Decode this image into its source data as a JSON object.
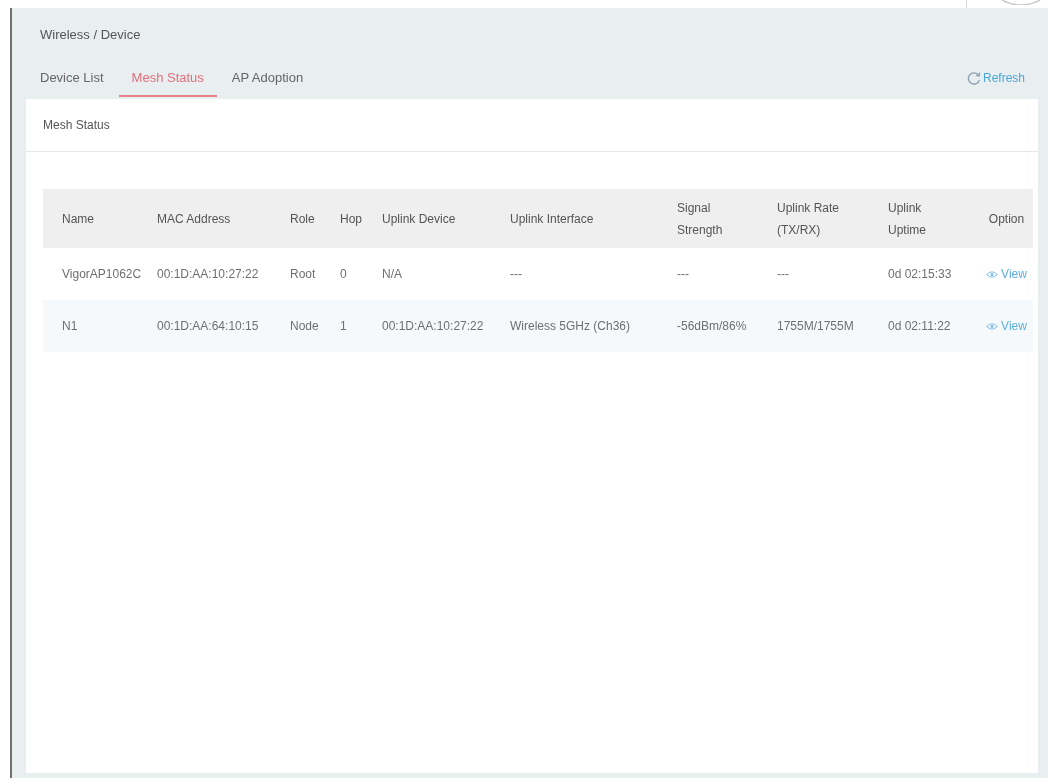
{
  "breadcrumb": "Wireless / Device",
  "tabs": [
    {
      "label": "Device List",
      "selected": false
    },
    {
      "label": "Mesh Status",
      "selected": true
    },
    {
      "label": "AP Adoption",
      "selected": false
    }
  ],
  "refresh_button": {
    "label": "Refresh"
  },
  "panel": {
    "title": "Mesh Status"
  },
  "table": {
    "columns": [
      "Name",
      "MAC Address",
      "Role",
      "Hop",
      "Uplink Device",
      "Uplink Interface",
      "Signal Strength",
      "Uplink Rate (TX/RX)",
      "Uplink Uptime",
      "Option"
    ],
    "rows": [
      {
        "cells": [
          "VigorAP1062C",
          "00:1D:AA:10:27:22",
          "Root",
          "0",
          "N/A",
          "---",
          "---",
          "---",
          "0d 02:15:33"
        ],
        "option": "View"
      },
      {
        "cells": [
          "N1",
          "00:1D:AA:64:10:15",
          "Node",
          "1",
          "00:1D:AA:10:27:22",
          "Wireless 5GHz (Ch36)",
          "-56dBm/86%",
          "1755M/1755M",
          "0d 02:11:22"
        ],
        "option": "View"
      }
    ]
  }
}
